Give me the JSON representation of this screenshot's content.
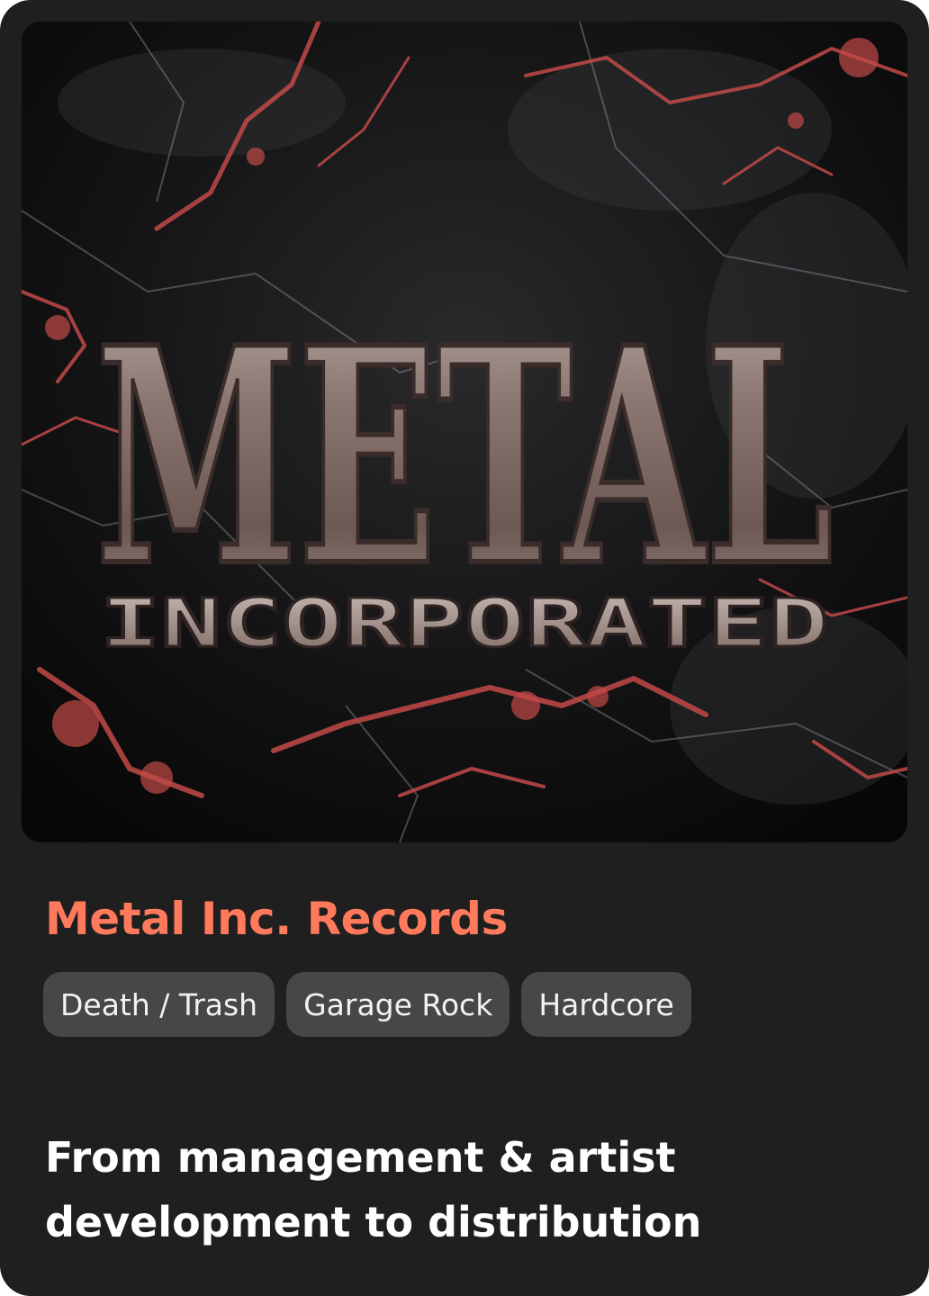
{
  "card": {
    "cover": {
      "logo_line1": "METAL",
      "logo_line2": "INCORPORATED"
    },
    "title": "Metal Inc. Records",
    "tags": [
      "Death / Trash",
      "Garage Rock",
      "Hardcore"
    ],
    "tagline_line1": "From management & artist",
    "tagline_line2": "development to distribution"
  },
  "colors": {
    "card_background": "#1f1f1f",
    "title_accent": "#ff7a5c",
    "tag_background": "#474747",
    "marble_veins": "#c24a48"
  }
}
